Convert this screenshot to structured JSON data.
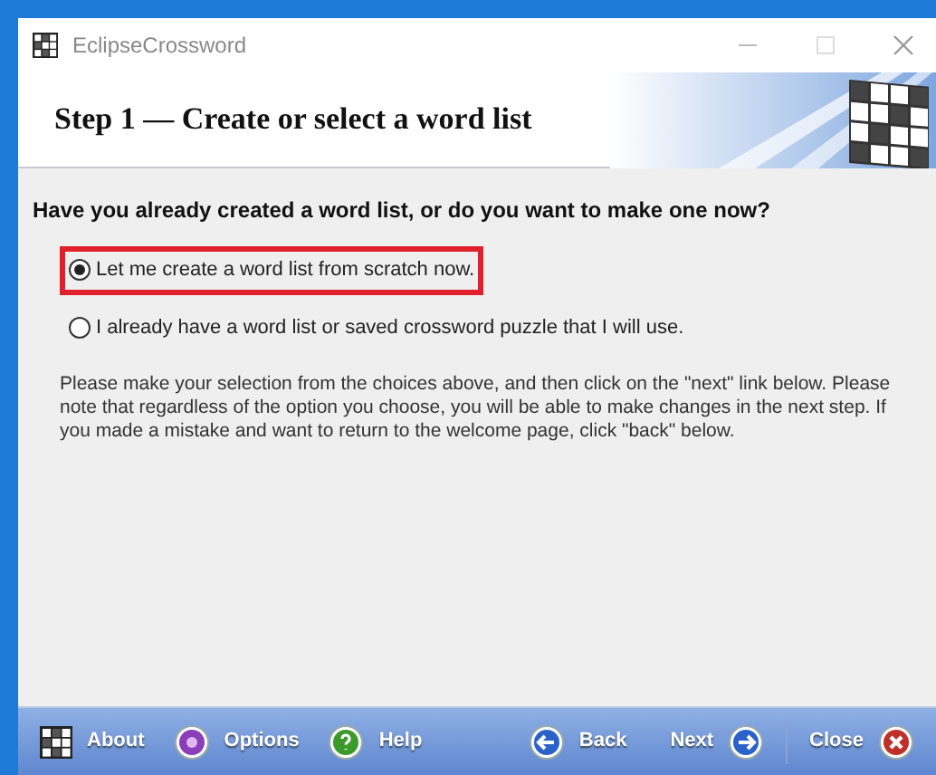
{
  "window": {
    "title": "EclipseCrossword"
  },
  "header": {
    "title": "Step 1 — Create or select a word list"
  },
  "question": "Have you already created a word list, or do you want to make one now?",
  "options": [
    {
      "label": "Let me create a word list from scratch now.",
      "selected": true,
      "highlighted": true
    },
    {
      "label": "I already have a word list or saved crossword puzzle that I will use.",
      "selected": false,
      "highlighted": false
    }
  ],
  "instructions": "Please make your selection from the choices above, and then click on the \"next\" link below. Please note that regardless of the option you choose, you will be able to make changes in the next step.  If you made a mistake and want to return to the welcome page, click \"back\" below.",
  "footer": [
    {
      "kind": "about",
      "label": "About"
    },
    {
      "kind": "options",
      "label": "Options"
    },
    {
      "kind": "help",
      "label": "Help"
    },
    {
      "kind": "back",
      "label": "Back"
    },
    {
      "kind": "next",
      "label": "Next"
    },
    {
      "kind": "close",
      "label": "Close"
    }
  ]
}
